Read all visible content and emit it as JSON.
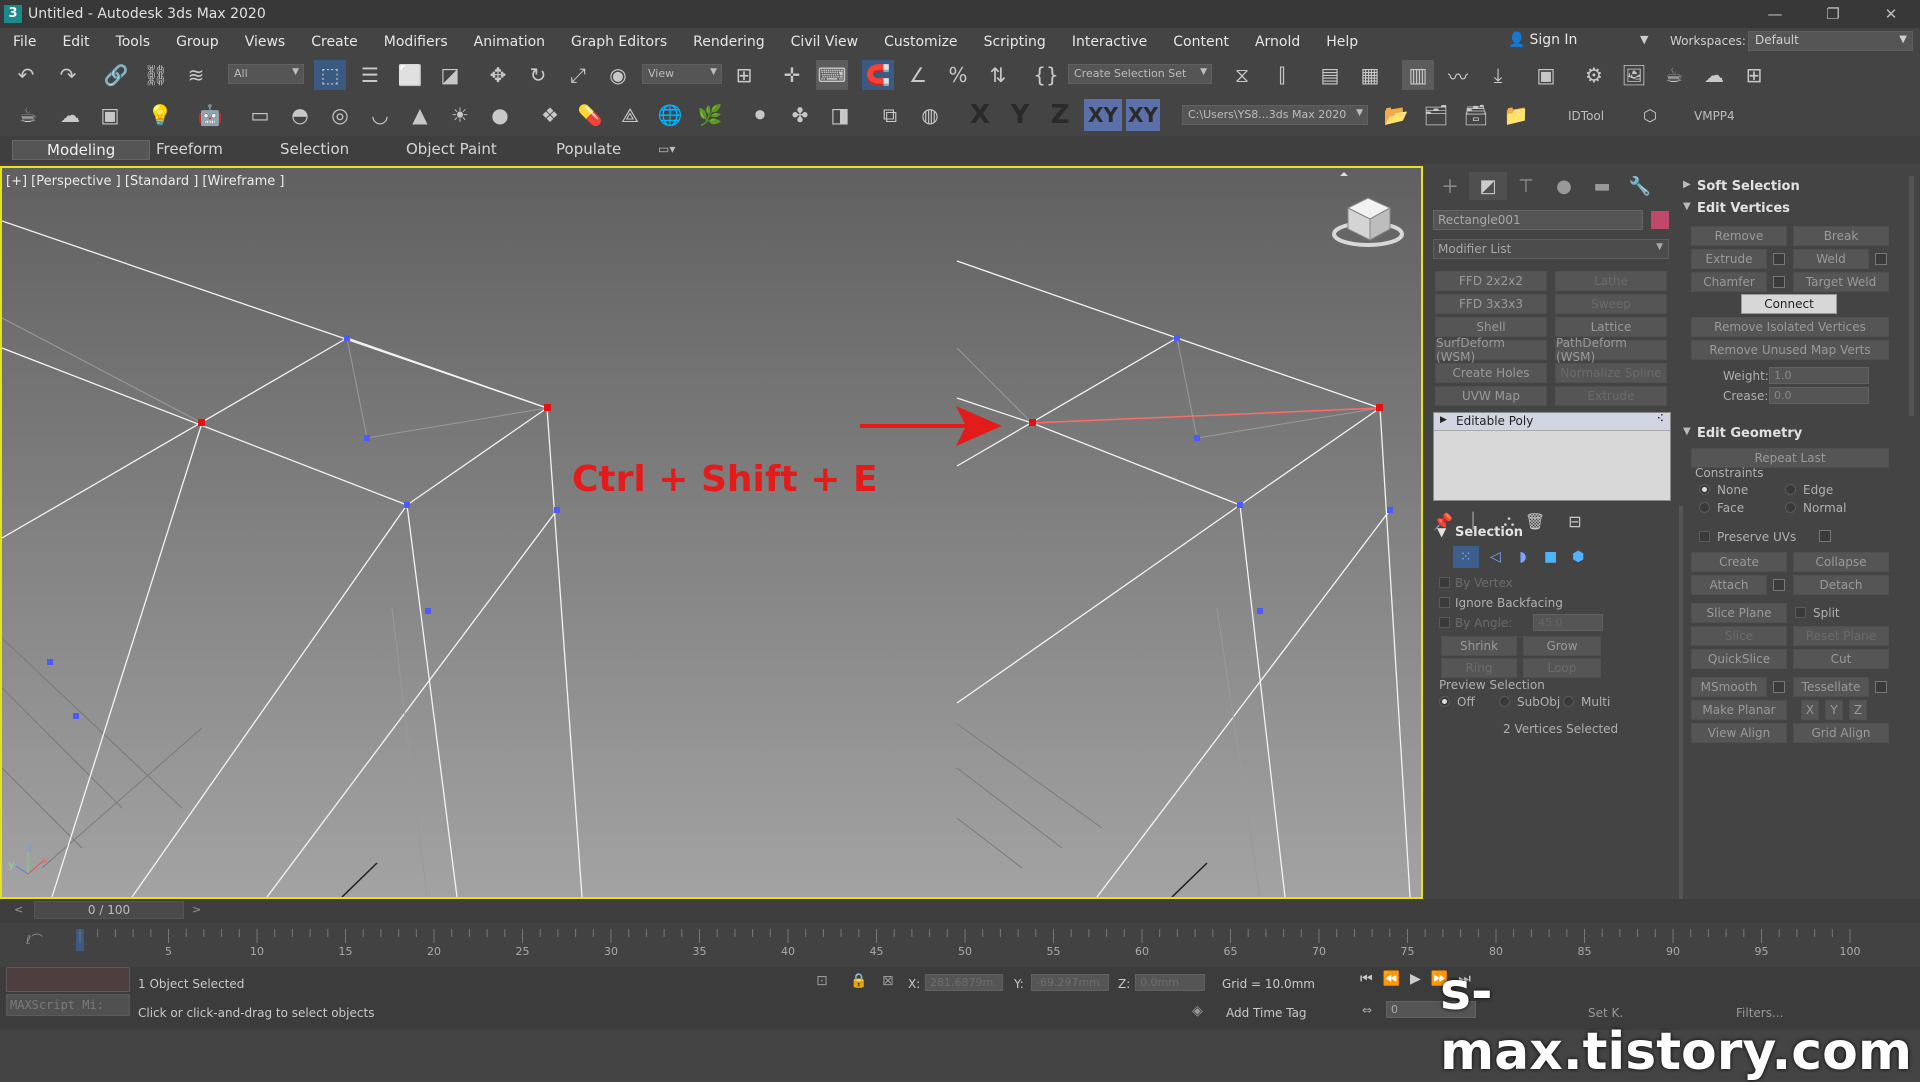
{
  "window": {
    "title": "Untitled - Autodesk 3ds Max 2020",
    "app_icon": "3",
    "controls": [
      "minimize-icon",
      "restore-icon",
      "close-icon"
    ]
  },
  "menu": {
    "items": [
      "File",
      "Edit",
      "Tools",
      "Group",
      "Views",
      "Create",
      "Modifiers",
      "Animation",
      "Graph Editors",
      "Rendering",
      "Civil View",
      "Customize",
      "Scripting",
      "Interactive",
      "Content",
      "Arnold",
      "Help"
    ],
    "sign_in": "Sign In",
    "workspaces_label": "Workspaces:",
    "workspace_value": "Default"
  },
  "toolbar1": {
    "filter_value": "All",
    "refcoord_value": "View",
    "selection_set_placeholder": "Create Selection Set"
  },
  "toolbar2": {
    "axes": [
      "X",
      "Y",
      "Z",
      "XY",
      "XY"
    ],
    "path_value": "C:\\Users\\YS8...3ds Max 2020",
    "idtool": "IDTool",
    "vmpp4": "VMPP4"
  },
  "ribbon": {
    "tabs": [
      "Modeling",
      "Freeform",
      "Selection",
      "Object Paint",
      "Populate"
    ],
    "active": "Modeling"
  },
  "viewport": {
    "label": "[+] [Perspective ] [Standard ] [Wireframe ]",
    "annotation": "Ctrl + Shift + E",
    "accent_color": "#e41b1b",
    "border_color": "#e8e020"
  },
  "command_panel": {
    "object_name": "Rectangle001",
    "object_color": "#c0496a",
    "modifier_list": "Modifier List",
    "modifier_buttons": [
      {
        "label": "FFD 2x2x2",
        "enabled": true
      },
      {
        "label": "Lathe",
        "enabled": false
      },
      {
        "label": "FFD 3x3x3",
        "enabled": true
      },
      {
        "label": "Sweep",
        "enabled": false
      },
      {
        "label": "Shell",
        "enabled": true
      },
      {
        "label": "Lattice",
        "enabled": true
      },
      {
        "label": "SurfDeform (WSM)",
        "enabled": true
      },
      {
        "label": "PathDeform (WSM)",
        "enabled": true
      },
      {
        "label": "Create Holes",
        "enabled": true
      },
      {
        "label": "Normalize Spline",
        "enabled": false
      },
      {
        "label": "UVW Map",
        "enabled": true
      },
      {
        "label": "Extrude",
        "enabled": false
      }
    ],
    "stack_item": "Editable Poly",
    "selection_rollout": {
      "title": "Selection",
      "by_vertex": "By Vertex",
      "ignore_backfacing": "Ignore Backfacing",
      "by_angle_label": "By Angle:",
      "by_angle_value": "45.0",
      "shrink": "Shrink",
      "grow": "Grow",
      "ring": "Ring",
      "loop": "Loop",
      "preview_label": "Preview Selection",
      "preview_options": [
        "Off",
        "SubObj",
        "Multi"
      ],
      "status": "2 Vertices Selected"
    },
    "soft_selection": "Soft Selection",
    "edit_vertices": {
      "title": "Edit Vertices",
      "remove": "Remove",
      "break": "Break",
      "extrude": "Extrude",
      "weld": "Weld",
      "chamfer": "Chamfer",
      "target_weld": "Target Weld",
      "connect": "Connect",
      "remove_isolated": "Remove Isolated Vertices",
      "remove_unused": "Remove Unused Map Verts",
      "weight_label": "Weight:",
      "weight_value": "1.0",
      "crease_label": "Crease:",
      "crease_value": "0.0"
    },
    "edit_geometry": {
      "title": "Edit Geometry",
      "repeat_last": "Repeat Last",
      "constraints_label": "Constraints",
      "constraints": [
        "None",
        "Edge",
        "Face",
        "Normal"
      ],
      "preserve_uvs": "Preserve UVs",
      "create": "Create",
      "collapse": "Collapse",
      "attach": "Attach",
      "detach": "Detach",
      "slice_plane": "Slice Plane",
      "split": "Split",
      "slice": "Slice",
      "reset_plane": "Reset Plane",
      "quickslice": "QuickSlice",
      "cut": "Cut",
      "msmooth": "MSmooth",
      "tessellate": "Tessellate",
      "make_planar": "Make Planar",
      "x": "X",
      "y": "Y",
      "z": "Z",
      "view_align": "View Align",
      "grid_align": "Grid Align"
    }
  },
  "timeline": {
    "frame_display": "0 / 100",
    "ticks": [
      "5",
      "10",
      "15",
      "20",
      "25",
      "30",
      "35",
      "40",
      "45",
      "50",
      "55",
      "60",
      "65",
      "70",
      "75",
      "80",
      "85",
      "90",
      "95",
      "100"
    ]
  },
  "status": {
    "maxscript": "MAXScript Mi:",
    "objects_selected": "1 Object Selected",
    "prompt": "Click or click-and-drag to select objects",
    "x_label": "X:",
    "x_value": "281.6879m",
    "y_label": "Y:",
    "y_value": "-69.297mm",
    "z_label": "Z:",
    "z_value": "0.0mm",
    "grid": "Grid = 10.0mm",
    "add_time_tag": "Add Time Tag",
    "frame_value": "0",
    "set_k": "Set K.",
    "filters": "Filters..."
  },
  "watermark": "s-max.tistory.com"
}
